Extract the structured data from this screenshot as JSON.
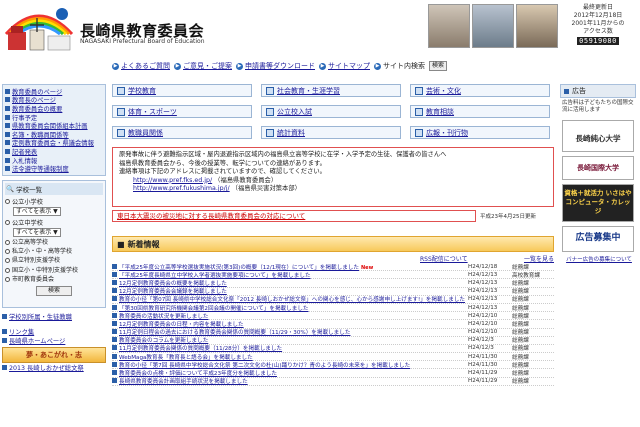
{
  "header": {
    "title": "長崎県教育委員会",
    "subtitle": "NAGASAKI Prefectural Board of Education",
    "updated": "最終更新日",
    "updated_date": "2012年12月18日",
    "since": "2001年11月からの",
    "access": "アクセス数",
    "counter": "05919080"
  },
  "topnav": {
    "items": [
      "よくあるご質問",
      "ご意見・ご提案",
      "申請書等ダウンロード",
      "サイトマップ",
      "サイト内検索"
    ],
    "search_label": "検索"
  },
  "sidebar": {
    "items": [
      "教育委員のページ",
      "教育長のページ",
      "教育委員会の概要",
      "行事予定",
      "県教育委員会関係組本計画",
      "名簿・教職員関係等",
      "定例教育委員会・県議会情報",
      "記者発表",
      "入札情報",
      "法令遵守等通報制度"
    ],
    "school_title": "学校一覧",
    "school_radio1": "公立小学校",
    "school_select1": "すべてを表示",
    "school_radio2": "公立中学校",
    "school_select2": "すべてを表示",
    "school_list": [
      "公立高等学校",
      "私立小・中・高等学校",
      "県立特別支援学校",
      "国立小・中特別支援学校",
      "市町教育委員会"
    ],
    "search_button": "検索",
    "school_link": "学校別所属・生徒教職",
    "bottom_items": [
      "リンク集",
      "長崎県ホームページ"
    ],
    "banner": "夢・あこがれ・志",
    "bottom_link": "2013 長崎しおかぜ総文祭"
  },
  "categories": [
    "学校教育",
    "社会教育・生涯学習",
    "芸術・文化",
    "体育・スポーツ",
    "公立校入試",
    "教育相談",
    "教職員関係",
    "統計資料",
    "広報・刊行物"
  ],
  "notice": {
    "lines": [
      "原発事故に伴う避難指示区域・屋内退避指示区域内の福島県立高等学校に在学・入学予定の生徒、保護者の皆さんへ",
      "福島県教育委員会から、今後の授業等、転学についての連絡があります。",
      "連絡事項は下記のアドレスに掲載されていますので、確認してください。"
    ],
    "url1": "http://www.pref.fks.ed.jp/",
    "url1_note": "（福島県教育委員会）",
    "url2": "http://www.pref.fukushima.jp/j/",
    "url2_note": "（福島県災害対策本部）"
  },
  "quake": {
    "text": "東日本大震災の被災地に対する長崎県教育委員会の対応について",
    "date": "平成23年4月25日更新"
  },
  "news": {
    "title": "新着情報",
    "rss": "RSS配信について",
    "list_link": "一覧を見る",
    "rows": [
      {
        "text": "「平成25年度公立高等学校選抜実施状況(第3回)の概要（12/1現在）について」を掲載しました",
        "date": "H24/12/18",
        "cat": "総務課",
        "new": "New"
      },
      {
        "text": "「平成25年度長崎県立中学校入学者選抜実施要項について」を掲載しました",
        "date": "H24/12/13",
        "cat": "高校教育課",
        "new": ""
      },
      {
        "text": "12月定例教育委員会の概要を掲載しました",
        "date": "H24/12/13",
        "cat": "総務課",
        "new": ""
      },
      {
        "text": "12月定例教育委員会会議録を掲載しました",
        "date": "H24/12/13",
        "cat": "総務課",
        "new": ""
      },
      {
        "text": "教育の小径「第07回 長崎県中学校総合文化祭「2012 長崎しおかぜ総文祭」への関心を感じ、心から感謝申し上げます!」を掲載しました",
        "date": "H24/12/13",
        "cat": "総務課",
        "new": ""
      },
      {
        "text": "「第30回県教育研究所機関会議第2回会議の開催について」を掲載しました",
        "date": "H24/12/13",
        "cat": "総務課",
        "new": ""
      },
      {
        "text": "教育委員の活動状況を更新しました",
        "date": "H24/12/10",
        "cat": "総務課",
        "new": ""
      },
      {
        "text": "12月定例教育委員会の日程・内容を掲載しました",
        "date": "H24/12/10",
        "cat": "総務課",
        "new": ""
      },
      {
        "text": "11月定例日程会の過去における教育委員会関係の質問概要（11/29・30%）を掲載しました",
        "date": "H24/12/10",
        "cat": "総務課",
        "new": ""
      },
      {
        "text": "教育委員会のコラムを更新しました",
        "date": "H24/12/3",
        "cat": "総務課",
        "new": ""
      },
      {
        "text": "11月定例教育委員会関係の質問概要（11/28分）を掲載しました",
        "date": "H24/12/3",
        "cat": "総務課",
        "new": ""
      },
      {
        "text": "WebMaga教育長「教育長と語る会」を掲載しました",
        "date": "H24/11/30",
        "cat": "総務課",
        "new": ""
      },
      {
        "text": "教育の小径「第7回 長崎県中学校総合文化祭 第二次文化の杜(山)踊りかけ？青のよう長崎の未来を」を掲載しました",
        "date": "H24/11/30",
        "cat": "総務課",
        "new": ""
      },
      {
        "text": "教育委員会の点検・評価について平成23年度分を掲載しました",
        "date": "H24/11/29",
        "cat": "総務課",
        "new": ""
      },
      {
        "text": "長崎県教育委員会計画取組手続状況を掲載しました",
        "date": "H24/11/29",
        "cat": "総務課",
        "new": ""
      }
    ]
  },
  "right": {
    "ad_title": "広告",
    "ad_text": "広告料は子どもたちの国際交流に活用します",
    "ad1": "長崎純心大学",
    "ad2": "長崎国際大学",
    "ad3": "資格＋就活力 いさはや コンピュータ・カレッジ",
    "ad4": "広告募集中",
    "ad_note": "バナー広告の募集について"
  },
  "colors": {
    "link": "#1a1a9a",
    "accent": "#2b5fa8",
    "warning": "#e05050",
    "news_header": "#f7c95a"
  }
}
